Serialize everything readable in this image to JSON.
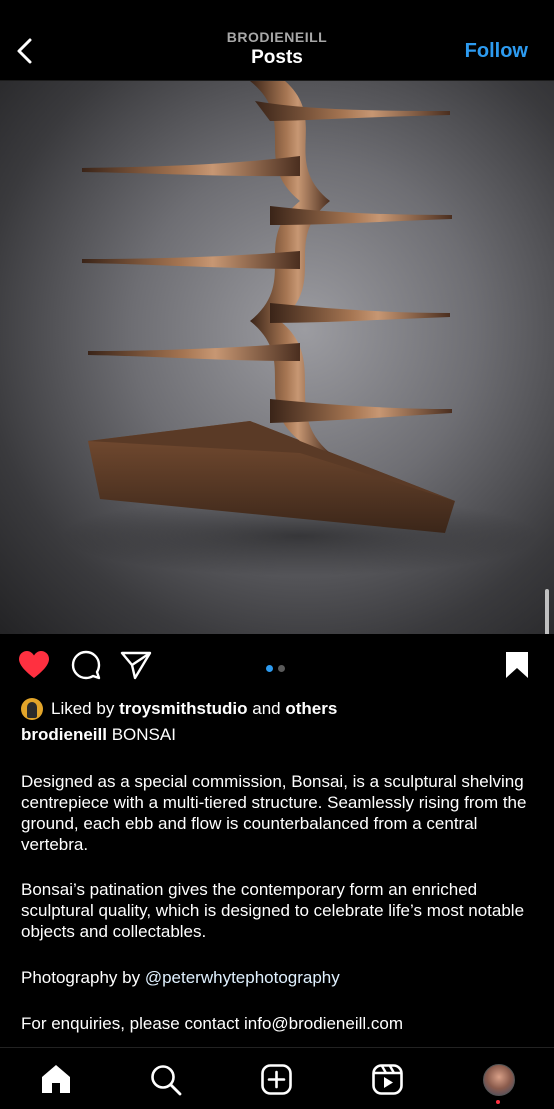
{
  "header": {
    "username": "BRODIENEILL",
    "title": "Posts",
    "follow_label": "Follow"
  },
  "post": {
    "carousel": {
      "count": 2,
      "active_index": 0
    },
    "liked": true,
    "likes": {
      "prefix": "Liked by",
      "user": "troysmithstudio",
      "joiner": "and",
      "others": "others"
    },
    "caption": {
      "username": "brodieneill",
      "title": "BONSAI",
      "paragraph1": "Designed as a special commission, Bonsai, is a sculptural shelving centrepiece with a multi-tiered structure. Seamlessly rising from the ground, each ebb and flow is counterbalanced from a central vertebra.",
      "paragraph2": "Bonsai’s patination gives the contemporary form an enriched sculptural quality, which is designed to celebrate life’s most notable objects and collectables.",
      "photo_prefix": "Photography by",
      "photo_credit": "@peterwhytephotography",
      "enquiries": "For enquiries, please contact info@brodieneill.com"
    }
  },
  "colors": {
    "accent": "#2d9bf0",
    "like": "#ff3040",
    "bronze": "#8a5a3a"
  },
  "nav": {
    "items": [
      "home-icon",
      "search-icon",
      "create-icon",
      "reels-icon",
      "profile-avatar"
    ],
    "active": "home-icon"
  }
}
